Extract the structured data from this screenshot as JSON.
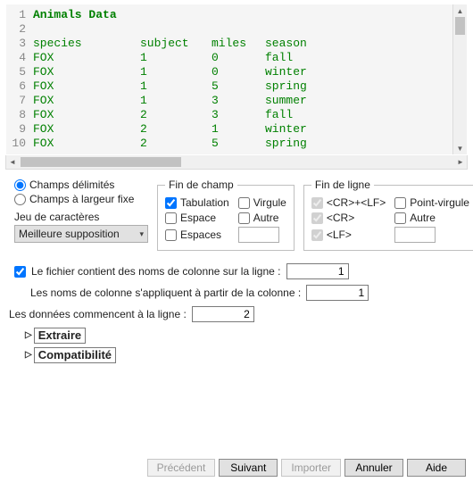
{
  "preview": {
    "rows": [
      {
        "n": "1",
        "cells": [
          "Animals Data",
          "",
          "",
          ""
        ],
        "bold": true
      },
      {
        "n": "2",
        "cells": [
          "",
          "",
          "",
          ""
        ]
      },
      {
        "n": "3",
        "cells": [
          "species",
          "subject",
          "miles",
          "season"
        ]
      },
      {
        "n": "4",
        "cells": [
          "FOX",
          "1",
          "0",
          "fall"
        ]
      },
      {
        "n": "5",
        "cells": [
          "FOX",
          "1",
          "0",
          "winter"
        ]
      },
      {
        "n": "6",
        "cells": [
          "FOX",
          "1",
          "5",
          "spring"
        ]
      },
      {
        "n": "7",
        "cells": [
          "FOX",
          "1",
          "3",
          "summer"
        ]
      },
      {
        "n": "8",
        "cells": [
          "FOX",
          "2",
          "3",
          "fall"
        ]
      },
      {
        "n": "9",
        "cells": [
          "FOX",
          "2",
          "1",
          "winter"
        ]
      },
      {
        "n": "10",
        "cells": [
          "FOX",
          "2",
          "5",
          "spring"
        ]
      }
    ]
  },
  "field_mode": {
    "delimited": "Champs délimités",
    "fixed": "Champs à largeur fixe"
  },
  "charset": {
    "label": "Jeu de caractères",
    "value": "Meilleure supposition"
  },
  "end_field": {
    "legend": "Fin de champ",
    "tab": "Tabulation",
    "space": "Espace",
    "spaces": "Espaces",
    "comma": "Virgule",
    "other": "Autre"
  },
  "end_line": {
    "legend": "Fin de ligne",
    "crlf": "<CR>+<LF>",
    "cr": "<CR>",
    "lf": "<LF>",
    "semicolon": "Point-virgule",
    "other": "Autre"
  },
  "middle": {
    "has_colnames": "Le fichier contient des noms de colonne sur la ligne :",
    "has_colnames_val": "1",
    "colnames_from": "Les noms de colonne s'appliquent à partir de la colonne :",
    "colnames_from_val": "1",
    "data_start": "Les données commencent à la ligne :",
    "data_start_val": "2"
  },
  "disclosures": {
    "extract": "Extraire",
    "compat": "Compatibilité"
  },
  "footer": {
    "prev": "Précédent",
    "next": "Suivant",
    "import": "Importer",
    "cancel": "Annuler",
    "help": "Aide"
  }
}
